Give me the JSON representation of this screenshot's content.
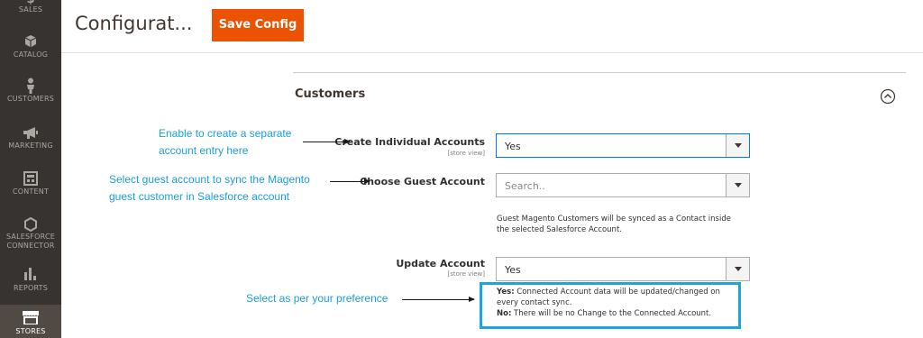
{
  "sidebar": {
    "items": [
      {
        "label": "SALES",
        "icon": "dollar-icon"
      },
      {
        "label": "CATALOG",
        "icon": "cube-icon"
      },
      {
        "label": "CUSTOMERS",
        "icon": "person-icon"
      },
      {
        "label": "MARKETING",
        "icon": "megaphone-icon"
      },
      {
        "label": "CONTENT",
        "icon": "layout-icon"
      },
      {
        "label_line1": "SALESFORCE",
        "label_line2": "CONNECTOR",
        "icon": "hexagon-icon"
      },
      {
        "label": "REPORTS",
        "icon": "bar-chart-icon"
      },
      {
        "label": "STORES",
        "icon": "storefront-icon",
        "active": true
      }
    ]
  },
  "header": {
    "title": "Configurat...",
    "save_label": "Save Config"
  },
  "section": {
    "title": "Customers",
    "collapse_icon": "chevron-up-circle-icon"
  },
  "fields": {
    "create_individual": {
      "label": "Create Individual Accounts",
      "scope": "[store view]",
      "value": "Yes"
    },
    "guest_account": {
      "label": "Choose Guest Account",
      "placeholder": "Search..",
      "note_line1": "Guest Magento Customers will be synced as a Contact inside",
      "note_line2": "the selected Salesforce Account."
    },
    "update_account": {
      "label": "Update Account",
      "scope": "[store view]",
      "value": "Yes",
      "note_yes_label": "Yes:",
      "note_yes_text": " Connected Account data will be updated/changed on",
      "note_yes_text2": "every contact sync.",
      "note_no_label": "No:",
      "note_no_text": " There will be no Change to the Connected Account."
    }
  },
  "annotations": {
    "create_line1": "Enable to create a separate",
    "create_line2": "account entry here",
    "guest_line1": "Select guest account to sync the Magento",
    "guest_line2": "guest customer in Salesforce account",
    "update_line1": "Select as per your preference"
  },
  "colors": {
    "accent": "#eb5202",
    "sidebar": "#373330",
    "annotation": "#1a9de0",
    "highlight": "#1ca3e3"
  }
}
